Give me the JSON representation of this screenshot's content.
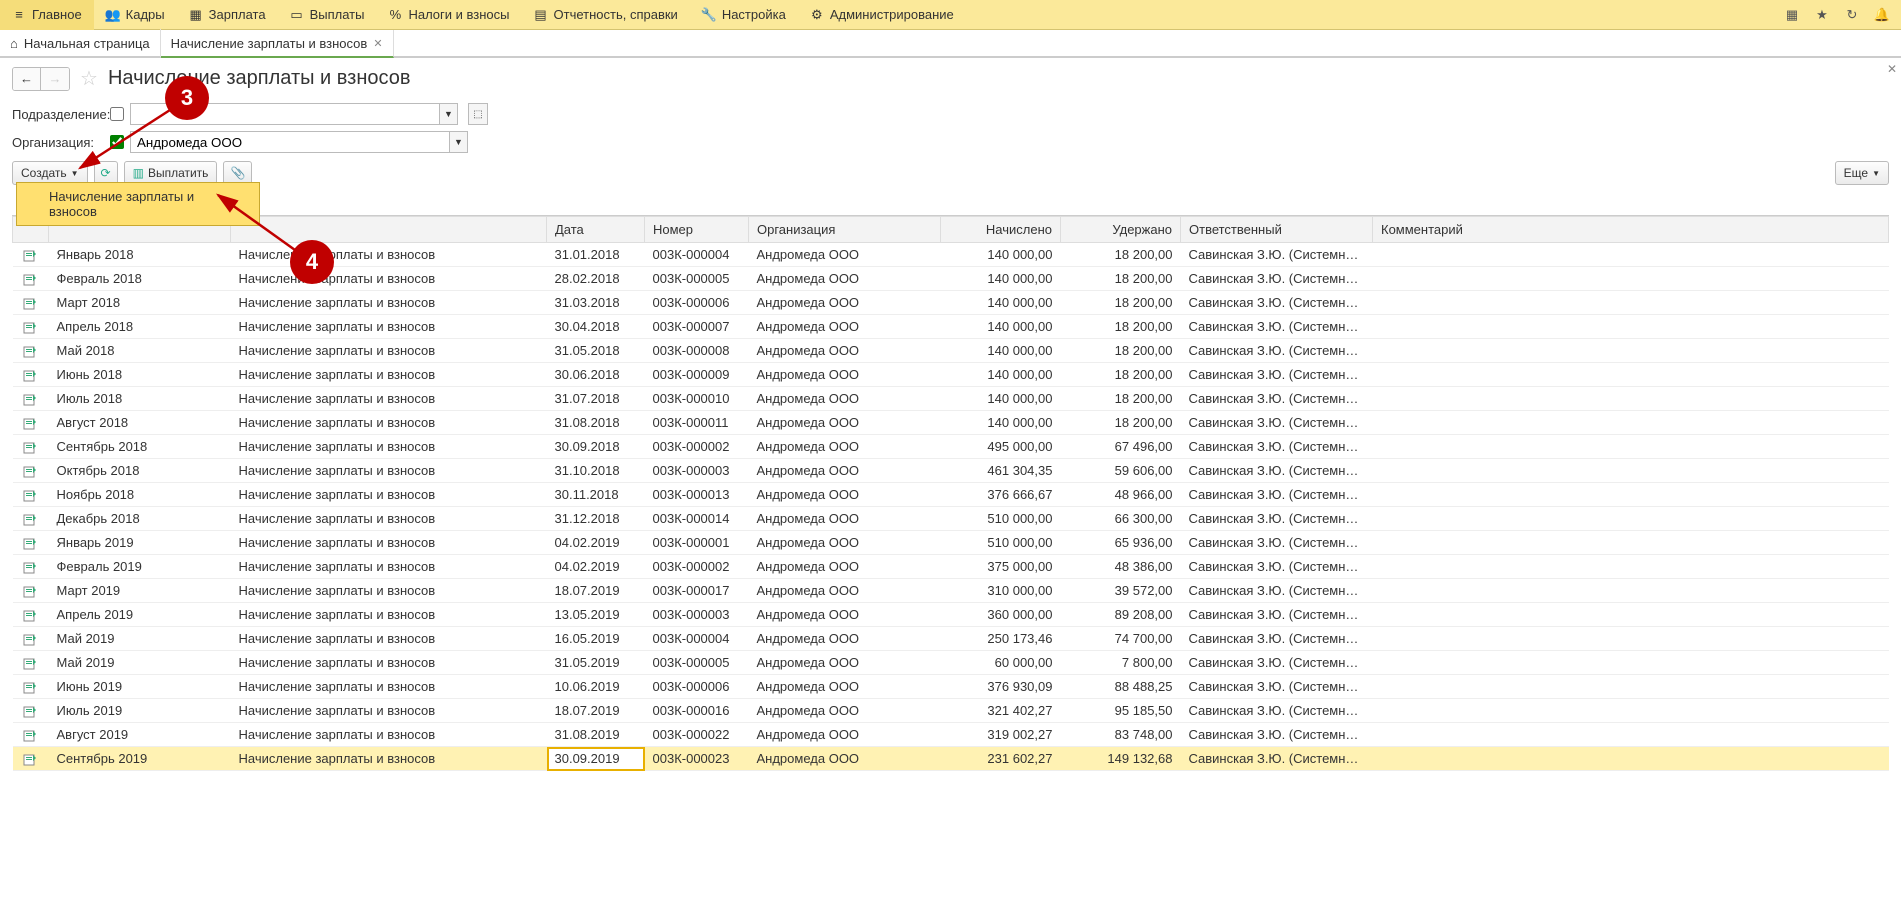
{
  "menu": [
    {
      "icon": "menu",
      "label": "Главное"
    },
    {
      "icon": "users",
      "label": "Кадры"
    },
    {
      "icon": "calendar",
      "label": "Зарплата"
    },
    {
      "icon": "cards",
      "label": "Выплаты"
    },
    {
      "icon": "percent",
      "label": "Налоги и взносы"
    },
    {
      "icon": "report",
      "label": "Отчетность, справки"
    },
    {
      "icon": "wrench",
      "label": "Настройка"
    },
    {
      "icon": "gear",
      "label": "Администрирование"
    }
  ],
  "tabs": {
    "home": "Начальная страница",
    "active": "Начисление зарплаты и взносов"
  },
  "page": {
    "title": "Начисление зарплаты и взносов"
  },
  "filters": {
    "dept_label": "Подразделение:",
    "dept_value": "",
    "org_label": "Организация:",
    "org_value": "Андромеда ООО"
  },
  "toolbar": {
    "create": "Создать",
    "pay": "Выплатить",
    "more": "Еще"
  },
  "dropdown": {
    "item1": "Начисление зарплаты и взносов"
  },
  "callouts": {
    "c3": "3",
    "c4": "4"
  },
  "table": {
    "headers": {
      "month": "",
      "type": "",
      "date": "Дата",
      "number": "Номер",
      "org": "Организация",
      "accrued": "Начислено",
      "withheld": "Удержано",
      "resp": "Ответственный",
      "comment": "Комментарий"
    },
    "rows": [
      {
        "month": "Январь 2018",
        "type": "Начисление зарплаты и взносов",
        "date": "31.01.2018",
        "number": "003К-000004",
        "org": "Андромеда ООО",
        "accrued": "140 000,00",
        "withheld": "18 200,00",
        "resp": "Савинская З.Ю. (Системный прогр..."
      },
      {
        "month": "Февраль 2018",
        "type": "Начисление зарплаты и взносов",
        "date": "28.02.2018",
        "number": "003К-000005",
        "org": "Андромеда ООО",
        "accrued": "140 000,00",
        "withheld": "18 200,00",
        "resp": "Савинская З.Ю. (Системный прогр..."
      },
      {
        "month": "Март 2018",
        "type": "Начисление зарплаты и взносов",
        "date": "31.03.2018",
        "number": "003К-000006",
        "org": "Андромеда ООО",
        "accrued": "140 000,00",
        "withheld": "18 200,00",
        "resp": "Савинская З.Ю. (Системный прогр..."
      },
      {
        "month": "Апрель 2018",
        "type": "Начисление зарплаты и взносов",
        "date": "30.04.2018",
        "number": "003К-000007",
        "org": "Андромеда ООО",
        "accrued": "140 000,00",
        "withheld": "18 200,00",
        "resp": "Савинская З.Ю. (Системный прогр..."
      },
      {
        "month": "Май 2018",
        "type": "Начисление зарплаты и взносов",
        "date": "31.05.2018",
        "number": "003К-000008",
        "org": "Андромеда ООО",
        "accrued": "140 000,00",
        "withheld": "18 200,00",
        "resp": "Савинская З.Ю. (Системный прогр..."
      },
      {
        "month": "Июнь 2018",
        "type": "Начисление зарплаты и взносов",
        "date": "30.06.2018",
        "number": "003К-000009",
        "org": "Андромеда ООО",
        "accrued": "140 000,00",
        "withheld": "18 200,00",
        "resp": "Савинская З.Ю. (Системный прогр..."
      },
      {
        "month": "Июль 2018",
        "type": "Начисление зарплаты и взносов",
        "date": "31.07.2018",
        "number": "003К-000010",
        "org": "Андромеда ООО",
        "accrued": "140 000,00",
        "withheld": "18 200,00",
        "resp": "Савинская З.Ю. (Системный прогр..."
      },
      {
        "month": "Август 2018",
        "type": "Начисление зарплаты и взносов",
        "date": "31.08.2018",
        "number": "003К-000011",
        "org": "Андромеда ООО",
        "accrued": "140 000,00",
        "withheld": "18 200,00",
        "resp": "Савинская З.Ю. (Системный прогр..."
      },
      {
        "month": "Сентябрь 2018",
        "type": "Начисление зарплаты и взносов",
        "date": "30.09.2018",
        "number": "003К-000002",
        "org": "Андромеда ООО",
        "accrued": "495 000,00",
        "withheld": "67 496,00",
        "resp": "Савинская З.Ю. (Системный прогр..."
      },
      {
        "month": "Октябрь 2018",
        "type": "Начисление зарплаты и взносов",
        "date": "31.10.2018",
        "number": "003К-000003",
        "org": "Андромеда ООО",
        "accrued": "461 304,35",
        "withheld": "59 606,00",
        "resp": "Савинская З.Ю. (Системный прогр..."
      },
      {
        "month": "Ноябрь 2018",
        "type": "Начисление зарплаты и взносов",
        "date": "30.11.2018",
        "number": "003К-000013",
        "org": "Андромеда ООО",
        "accrued": "376 666,67",
        "withheld": "48 966,00",
        "resp": "Савинская З.Ю. (Системный прогр..."
      },
      {
        "month": "Декабрь 2018",
        "type": "Начисление зарплаты и взносов",
        "date": "31.12.2018",
        "number": "003К-000014",
        "org": "Андромеда ООО",
        "accrued": "510 000,00",
        "withheld": "66 300,00",
        "resp": "Савинская З.Ю. (Системный прогр..."
      },
      {
        "month": "Январь 2019",
        "type": "Начисление зарплаты и взносов",
        "date": "04.02.2019",
        "number": "003К-000001",
        "org": "Андромеда ООО",
        "accrued": "510 000,00",
        "withheld": "65 936,00",
        "resp": "Савинская З.Ю. (Системный прогр..."
      },
      {
        "month": "Февраль 2019",
        "type": "Начисление зарплаты и взносов",
        "date": "04.02.2019",
        "number": "003К-000002",
        "org": "Андромеда ООО",
        "accrued": "375 000,00",
        "withheld": "48 386,00",
        "resp": "Савинская З.Ю. (Системный прогр..."
      },
      {
        "month": "Март 2019",
        "type": "Начисление зарплаты и взносов",
        "date": "18.07.2019",
        "number": "003К-000017",
        "org": "Андромеда ООО",
        "accrued": "310 000,00",
        "withheld": "39 572,00",
        "resp": "Савинская З.Ю. (Системный прогр..."
      },
      {
        "month": "Апрель 2019",
        "type": "Начисление зарплаты и взносов",
        "date": "13.05.2019",
        "number": "003К-000003",
        "org": "Андромеда ООО",
        "accrued": "360 000,00",
        "withheld": "89 208,00",
        "resp": "Савинская З.Ю. (Системный прогр..."
      },
      {
        "month": "Май 2019",
        "type": "Начисление зарплаты и взносов",
        "date": "16.05.2019",
        "number": "003К-000004",
        "org": "Андромеда ООО",
        "accrued": "250 173,46",
        "withheld": "74 700,00",
        "resp": "Савинская З.Ю. (Системный прогр..."
      },
      {
        "month": "Май 2019",
        "type": "Начисление зарплаты и взносов",
        "date": "31.05.2019",
        "number": "003К-000005",
        "org": "Андромеда ООО",
        "accrued": "60 000,00",
        "withheld": "7 800,00",
        "resp": "Савинская З.Ю. (Системный прогр..."
      },
      {
        "month": "Июнь 2019",
        "type": "Начисление зарплаты и взносов",
        "date": "10.06.2019",
        "number": "003К-000006",
        "org": "Андромеда ООО",
        "accrued": "376 930,09",
        "withheld": "88 488,25",
        "resp": "Савинская З.Ю. (Системный прогр..."
      },
      {
        "month": "Июль 2019",
        "type": "Начисление зарплаты и взносов",
        "date": "18.07.2019",
        "number": "003К-000016",
        "org": "Андромеда ООО",
        "accrued": "321 402,27",
        "withheld": "95 185,50",
        "resp": "Савинская З.Ю. (Системный прогр..."
      },
      {
        "month": "Август 2019",
        "type": "Начисление зарплаты и взносов",
        "date": "31.08.2019",
        "number": "003К-000022",
        "org": "Андромеда ООО",
        "accrued": "319 002,27",
        "withheld": "83 748,00",
        "resp": "Савинская З.Ю. (Системный прогр..."
      },
      {
        "month": "Сентябрь 2019",
        "type": "Начисление зарплаты и взносов",
        "date": "30.09.2019",
        "number": "003К-000023",
        "org": "Андромеда ООО",
        "accrued": "231 602,27",
        "withheld": "149 132,68",
        "resp": "Савинская З.Ю. (Системный прогр...",
        "selected": true
      }
    ]
  }
}
